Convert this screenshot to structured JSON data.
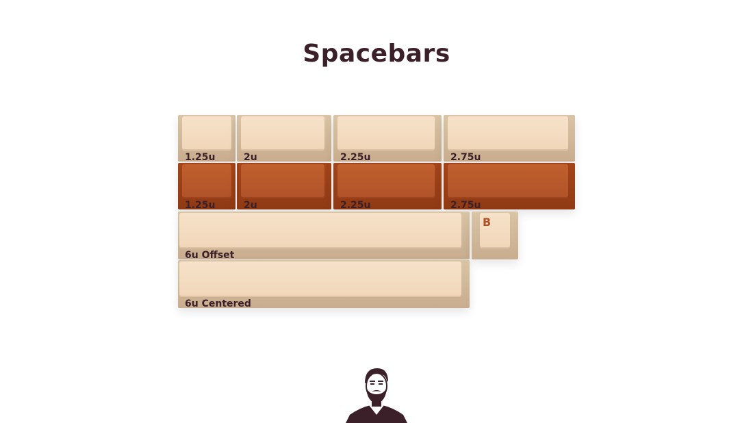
{
  "title": "Spacebars",
  "rows": [
    {
      "colorway": "cream",
      "keys": [
        "1.25u",
        "2u",
        "2.25u",
        "2.75u"
      ]
    },
    {
      "colorway": "orange",
      "keys": [
        "1.25u",
        "2u",
        "2.25u",
        "2.75u"
      ]
    }
  ],
  "spacebars": {
    "offset": "6u Offset",
    "centered": "6u Centered"
  },
  "b_key": "B",
  "colors": {
    "cream": "#f3dcc0",
    "orange": "#b0522a",
    "text": "#3b1f29"
  },
  "logo_icon": "bearded-man-logo"
}
